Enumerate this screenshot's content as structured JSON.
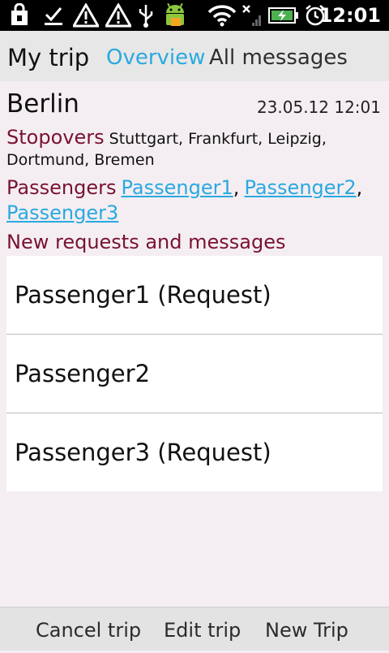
{
  "status_bar": {
    "time": "12:01",
    "icons": [
      "lock-bag-icon",
      "download-done-icon",
      "warning-icon",
      "warning-icon",
      "usb-icon",
      "android-icon",
      "wifi-icon",
      "no-signal-icon",
      "battery-charging-icon",
      "alarm-clock-icon"
    ]
  },
  "tabs": {
    "title": "My trip",
    "overview": "Overview",
    "all_messages": "All messages"
  },
  "trip": {
    "destination": "Berlin",
    "datetime": "23.05.12 12:01",
    "stopovers_label": "Stopovers",
    "stopovers_line1": "Stuttgart, Frankfurt, Leipzig,",
    "stopovers_line2": "Dortmund, Bremen",
    "passengers_label": "Passengers",
    "passengers": [
      "Passenger1",
      "Passenger2",
      "Passenger3"
    ],
    "separator": ",",
    "new_requests_label": "New requests and messages"
  },
  "messages": [
    {
      "label": "Passenger1 (Request)"
    },
    {
      "label": "Passenger2"
    },
    {
      "label": "Passenger3 (Request)"
    }
  ],
  "bottom_bar": {
    "cancel_trip": "Cancel trip",
    "edit_trip": "Edit trip",
    "new_trip": "New Trip"
  },
  "colors": {
    "accent_blue": "#2aa9e0",
    "label_maroon": "#7a1232",
    "background": "#f4eef2"
  }
}
